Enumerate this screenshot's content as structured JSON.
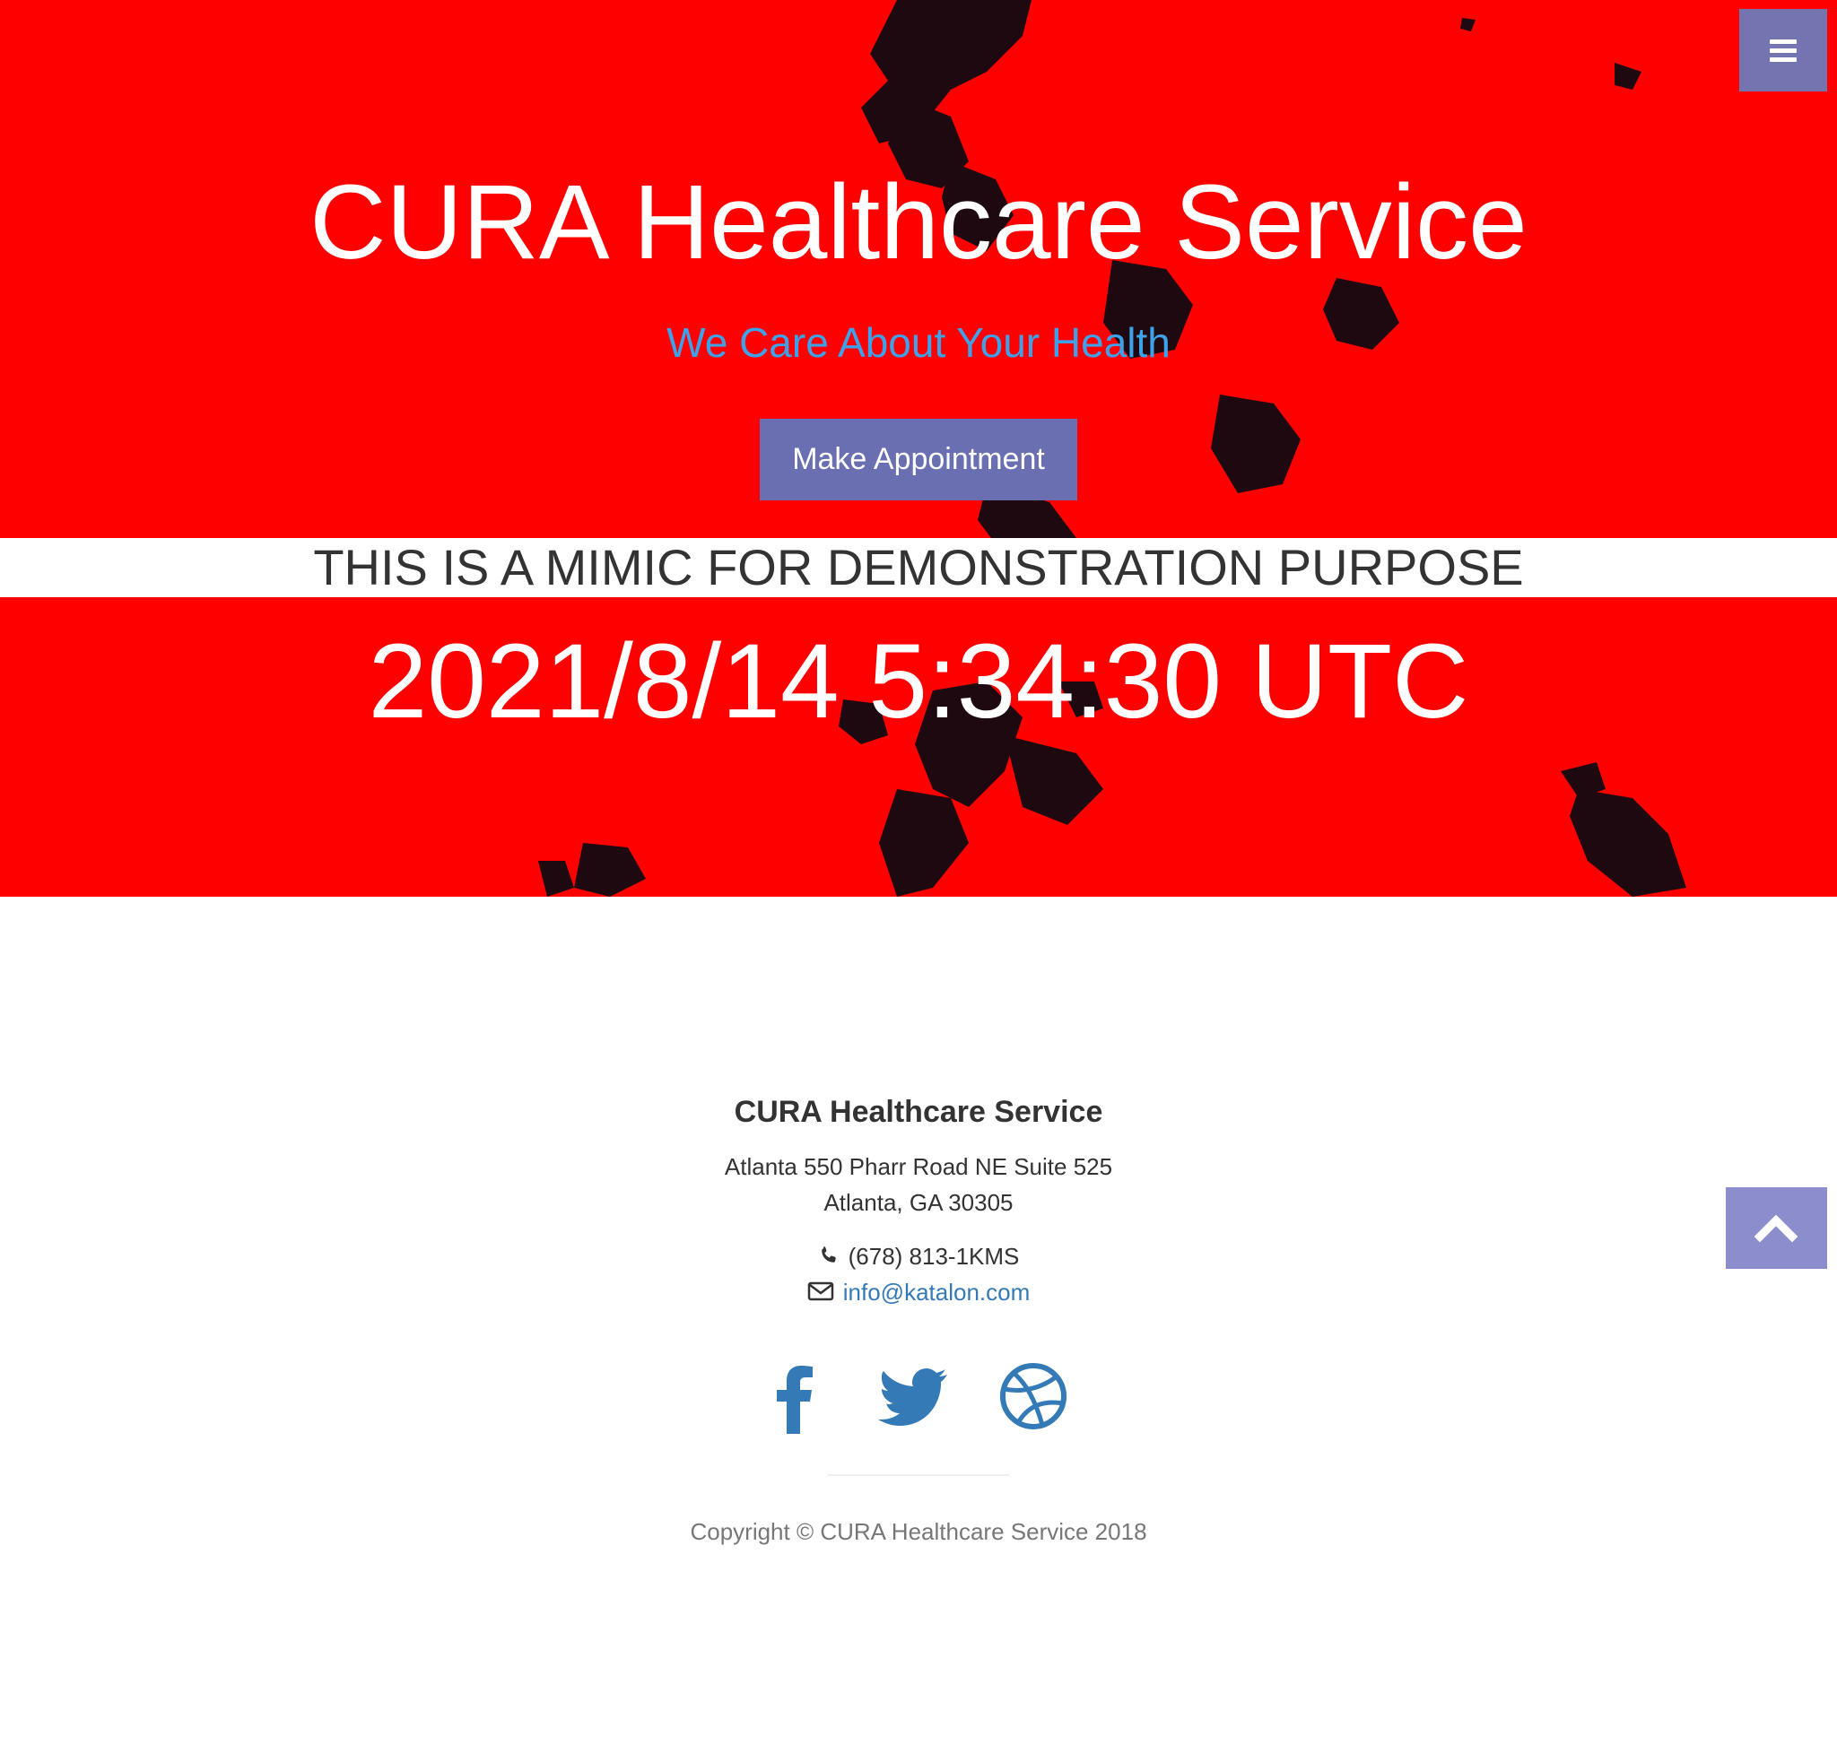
{
  "hero": {
    "title": "CURA Healthcare Service",
    "tagline": "We Care About Your Health",
    "appointment_button": "Make Appointment",
    "demo_banner": "THIS IS A MIMIC FOR DEMONSTRATION PURPOSE",
    "clock": "2021/8/14 5:34:30 UTC"
  },
  "nav": {
    "menu_icon": "bars-icon"
  },
  "footer": {
    "title": "CURA Healthcare Service",
    "address_line1": "Atlanta 550 Pharr Road NE Suite 525",
    "address_line2": "Atlanta, GA 30305",
    "phone": "(678) 813-1KMS",
    "email": "info@katalon.com",
    "social": [
      "facebook-icon",
      "twitter-icon",
      "dribbble-icon"
    ],
    "copyright": "Copyright © CURA Healthcare Service 2018"
  },
  "colors": {
    "hero_background": "#ff0000",
    "tagline": "#3da2ea",
    "button": "#6a6fb2",
    "link": "#337ab7",
    "to_top_button": "#8b8dcc"
  }
}
